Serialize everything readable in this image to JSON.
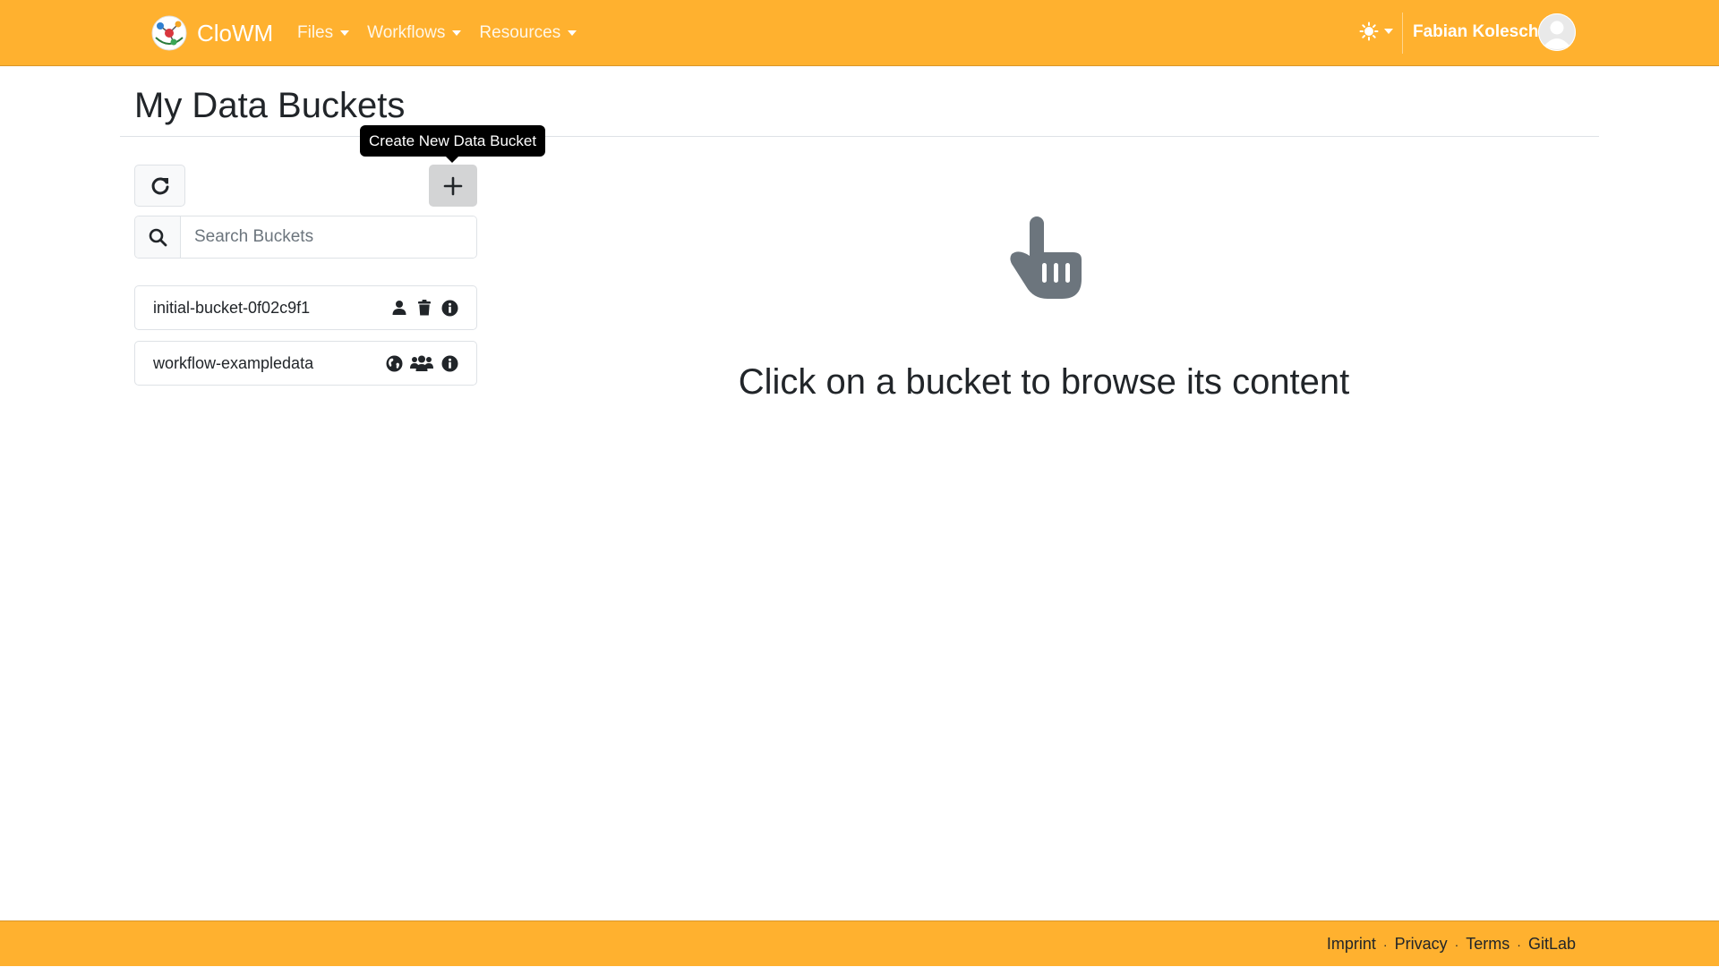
{
  "app": {
    "brand": "CloWM",
    "nav": [
      {
        "label": "Files"
      },
      {
        "label": "Workflows"
      },
      {
        "label": "Resources"
      }
    ],
    "user": {
      "name": "Fabian Kolesch"
    }
  },
  "page": {
    "title": "My Data Buckets",
    "tooltip": "Create New Data Bucket",
    "search": {
      "placeholder": "Search Buckets",
      "value": ""
    },
    "buckets": [
      {
        "name": "initial-bucket-0f02c9f1",
        "icons": [
          "user-icon",
          "trash-icon",
          "info-icon"
        ]
      },
      {
        "name": "workflow-exampledata",
        "icons": [
          "globe-icon",
          "users-icon",
          "info-icon"
        ]
      }
    ],
    "empty_state": "Click on a bucket to browse its content"
  },
  "footer": {
    "links": [
      "Imprint",
      "Privacy",
      "Terms",
      "GitLab"
    ]
  },
  "colors": {
    "accent": "#ffb12f",
    "icon_gray": "#6c757d"
  }
}
